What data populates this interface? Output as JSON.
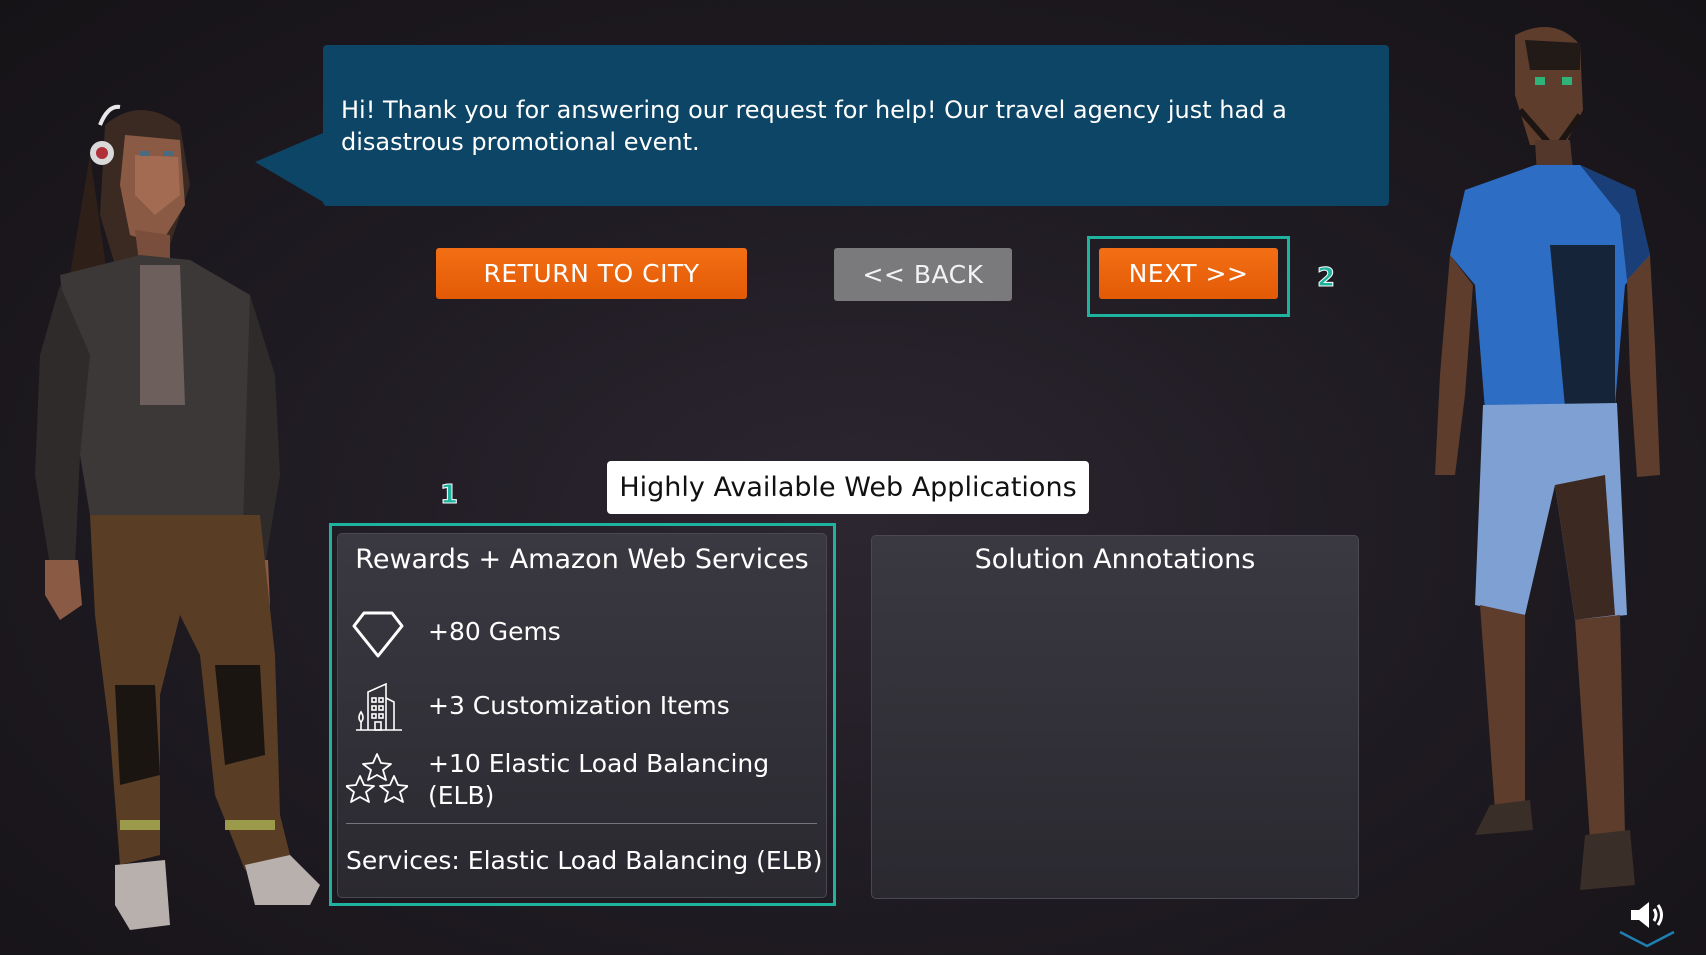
{
  "dialog": {
    "message": "Hi! Thank you for answering our request for help! Our travel agency just had a disastrous promotional event."
  },
  "buttons": {
    "return_label": "RETURN TO CITY",
    "back_label": "<< BACK",
    "next_label": "NEXT >>"
  },
  "markers": {
    "one": "1",
    "two": "2"
  },
  "quest_title": "Highly Available Web Applications",
  "rewards": {
    "title": "Rewards + Amazon Web Services",
    "items": [
      {
        "icon": "gem-icon",
        "label": "+80 Gems"
      },
      {
        "icon": "city-building-icon",
        "label": "+3 Customization Items"
      },
      {
        "icon": "stars-icon",
        "label": "+10 Elastic Load Balancing (ELB)"
      }
    ],
    "services": "Services: Elastic Load Balancing (ELB)"
  },
  "annotations": {
    "title": "Solution Annotations"
  },
  "colors": {
    "accent_orange": "#f36f14",
    "bubble_blue": "#0d4566",
    "highlight_teal": "#1db39e"
  }
}
